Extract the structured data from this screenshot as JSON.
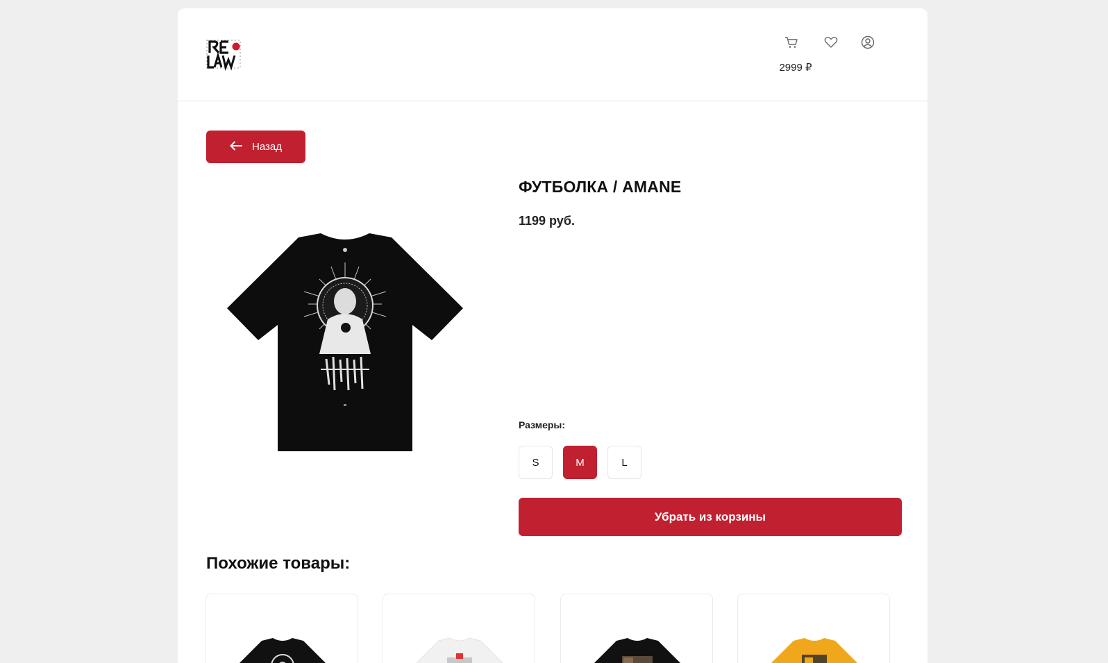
{
  "header": {
    "logo_text": "RE LAW",
    "cart_total": "2999 ₽",
    "icons": [
      "cart-icon",
      "heart-icon",
      "user-icon"
    ]
  },
  "back_button": {
    "label": "Назад"
  },
  "product": {
    "title": "ФУТБОЛКА / AMANE",
    "price": "1199 руб.",
    "sizes_label": "Размеры:",
    "sizes": [
      "S",
      "M",
      "L"
    ],
    "selected_size": "M",
    "remove_button": "Убрать из корзины"
  },
  "similar": {
    "title": "Похожие товары:",
    "items": [
      {
        "shirt_color": "#111111"
      },
      {
        "shirt_color": "#f2f2f2"
      },
      {
        "shirt_color": "#111111"
      },
      {
        "shirt_color": "#f0a71c"
      }
    ]
  },
  "colors": {
    "accent": "#c0202f",
    "background": "#efefef"
  }
}
